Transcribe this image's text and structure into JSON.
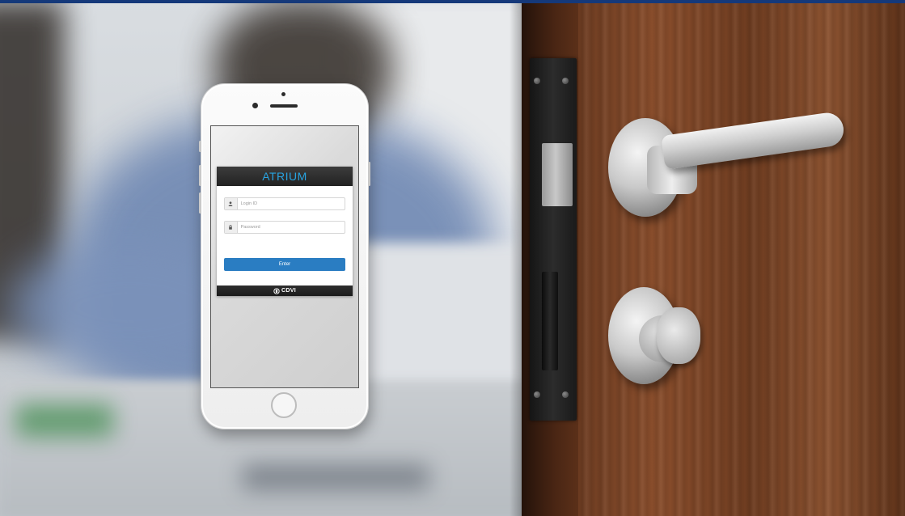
{
  "login_card": {
    "logo_text": "ATRIUM",
    "login_id_placeholder": "Login ID",
    "password_placeholder": "Password",
    "enter_label": "Enter",
    "footer_brand": "CDVI"
  },
  "icons": {
    "login_field": "user-icon",
    "password_field": "lock-icon",
    "footer": "cdvi-logo-icon"
  },
  "colors": {
    "top_strip": "#15397a",
    "logo_accent": "#28a3e0",
    "enter_button": "#2a7dc2",
    "card_header": "#222222"
  }
}
